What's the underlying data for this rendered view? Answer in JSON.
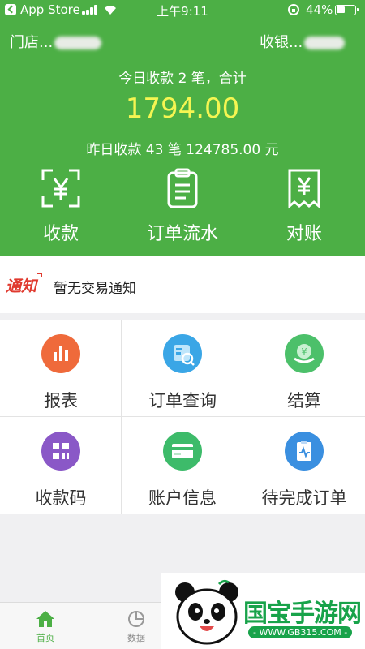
{
  "status_bar": {
    "carrier": "App Store",
    "time": "上午9:11",
    "battery": "44%"
  },
  "header": {
    "store_label": "门店...",
    "cashier_label": "收银...",
    "today_summary": "今日收款 2 笔，合计",
    "today_amount": "1794.00",
    "yesterday_summary": "昨日收款 43 笔 124785.00 元",
    "actions": [
      {
        "label": "收款",
        "icon": "scan-yuan-icon"
      },
      {
        "label": "订单流水",
        "icon": "clipboard-icon"
      },
      {
        "label": "对账",
        "icon": "receipt-yuan-icon"
      }
    ]
  },
  "notice": {
    "tag": "通知",
    "text": "暂无交易通知"
  },
  "grid": [
    {
      "label": "报表",
      "icon": "bar-chart-icon",
      "color": "#ef6a3b"
    },
    {
      "label": "订单查询",
      "icon": "order-search-icon",
      "color": "#3aa6e6"
    },
    {
      "label": "结算",
      "icon": "settlement-icon",
      "color": "#4cc06a"
    },
    {
      "label": "收款码",
      "icon": "qr-grid-icon",
      "color": "#8a58c7"
    },
    {
      "label": "账户信息",
      "icon": "card-icon",
      "color": "#3dbb6a"
    },
    {
      "label": "待完成订单",
      "icon": "pending-order-icon",
      "color": "#3a8fe0"
    }
  ],
  "tabbar": [
    {
      "label": "首页",
      "icon": "home-icon",
      "active": true
    },
    {
      "label": "数据",
      "icon": "pie-chart-icon",
      "active": false
    }
  ],
  "watermark": {
    "title": "国宝手游网",
    "url": "- WWW.GB315.COM -"
  },
  "colors": {
    "brand_green": "#4caf45",
    "amount_yellow": "#f5f552",
    "notice_red": "#e03a2f"
  }
}
